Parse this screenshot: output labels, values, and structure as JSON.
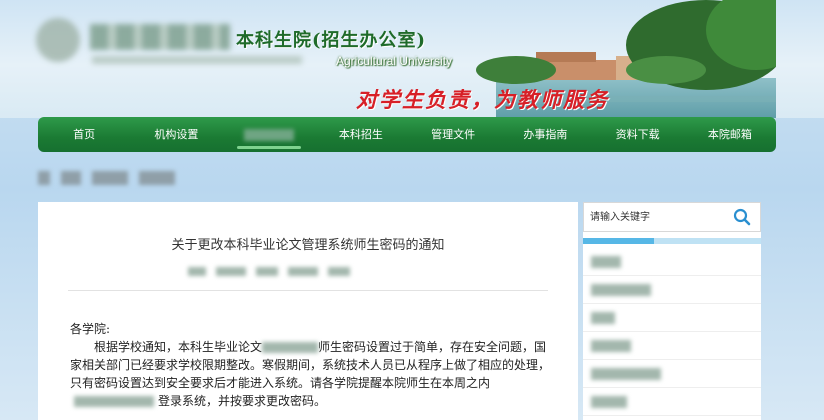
{
  "header": {
    "office_title": "本科生院(招生办公室)",
    "office_subtitle": "Agricultural  University",
    "slogan": "对学生负责，为教师服务"
  },
  "nav": {
    "items": [
      {
        "label": "首页"
      },
      {
        "label": "机构设置"
      },
      {
        "label": ""
      },
      {
        "label": "本科招生"
      },
      {
        "label": "管理文件"
      },
      {
        "label": "办事指南"
      },
      {
        "label": "资料下载"
      },
      {
        "label": "本院邮箱"
      }
    ]
  },
  "article": {
    "title": "关于更改本科毕业论文管理系统师生密码的通知",
    "salutation": "各学院:",
    "para1_a": "根据学校通知，本科生毕业论文",
    "para1_b": "师生密码设置过于简单，存在安全问题，国家相关部门已经要求学校限期整改。寒假期间，系统技术人员已从程序上做了相应的处理，只有密码设置达到安全要求后才能进入系统。请各学院提醒本院师生在本周之内",
    "para1_c": "登录系统，并按要求更改密码。"
  },
  "sidebar": {
    "search_placeholder": "请输入关键字",
    "accent_color": "#56b7e6"
  },
  "colors": {
    "nav_green": "#1b7a33",
    "slogan_red": "#d72027",
    "title_green": "#1f6b2a"
  }
}
